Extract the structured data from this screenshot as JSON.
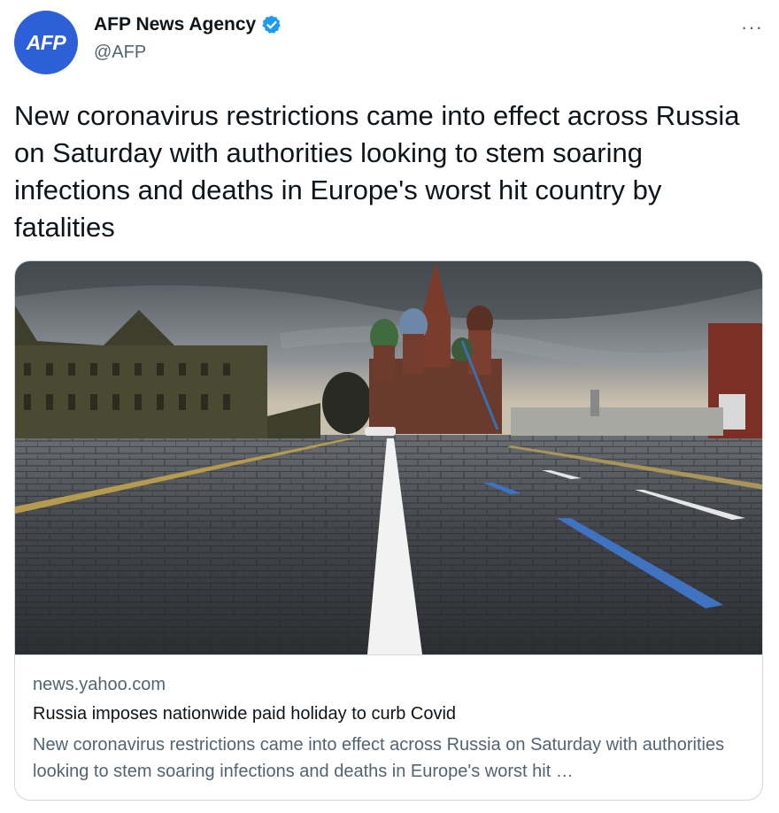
{
  "author": {
    "avatar_text": "AFP",
    "display_name": "AFP News Agency",
    "handle": "@AFP",
    "verified": true,
    "avatar_color": "#2d5fd8"
  },
  "more_label": "···",
  "tweet": {
    "text": "New coronavirus restrictions came into effect across Russia on Saturday with authorities looking to stem soaring infections and deaths in Europe's worst hit country by fatalities"
  },
  "card": {
    "domain": "news.yahoo.com",
    "title": "Russia imposes nationwide paid holiday to curb Covid",
    "description": "New coronavirus restrictions came into effect across Russia on Saturday with authorities looking to stem soaring infections and deaths in Europe's worst hit …"
  },
  "colors": {
    "text_primary": "#0f1419",
    "text_secondary": "#536471",
    "border": "#cfd9de",
    "verified_blue": "#1d9bf0"
  },
  "icons": {
    "verified": "verified-badge-icon",
    "more": "more-options-icon"
  }
}
